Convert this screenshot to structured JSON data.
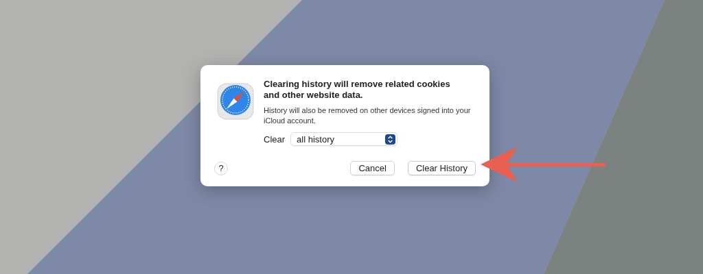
{
  "dialog": {
    "title": "Clearing history will remove related cookies and other website data.",
    "message": "History will also be removed on other devices signed into your iCloud account.",
    "clear_label": "Clear",
    "clear_popup": {
      "value": "all history"
    },
    "help_button": "?",
    "buttons": [
      {
        "label": "Cancel",
        "kind": "secondary"
      },
      {
        "label": "Clear History",
        "kind": "default"
      }
    ]
  }
}
